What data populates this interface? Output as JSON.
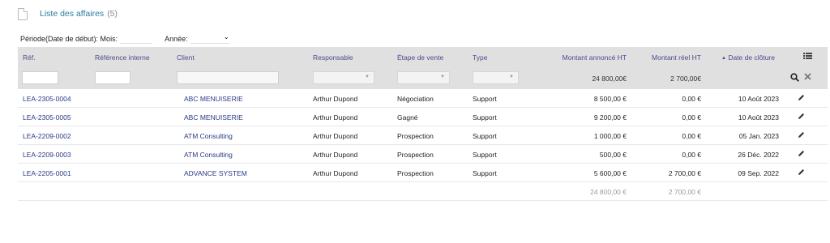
{
  "page": {
    "title": "Liste des affaires",
    "count": "(5)"
  },
  "filters": {
    "period_label": "Période(Date de début): Mois:",
    "year_label": "Année:"
  },
  "table": {
    "headers": {
      "ref": "Réf.",
      "ref_int": "Référence interne",
      "client": "Client",
      "responsable": "Responsable",
      "etape": "Étape de vente",
      "type": "Type",
      "montant_annonce": "Montant annoncé HT",
      "montant_reel": "Montant réel HT",
      "date_cloture": "Date de clôture",
      "sort_indicator": "▲"
    },
    "header_totals": {
      "montant_annonce": "24 800,00€",
      "montant_reel": "2 700,00€"
    },
    "rows": [
      {
        "ref": "LEA-2305-0004",
        "client": "ABC MENUISERIE",
        "responsable": "Arthur Dupond",
        "etape": "Négociation",
        "type": "Support",
        "montant_annonce": "8 500,00 €",
        "montant_reel": "0,00 €",
        "date": "10 Août 2023"
      },
      {
        "ref": "LEA-2305-0005",
        "client": "ABC MENUISERIE",
        "responsable": "Arthur Dupond",
        "etape": "Gagné",
        "type": "Support",
        "montant_annonce": "9 200,00 €",
        "montant_reel": "0,00 €",
        "date": "10 Août 2023"
      },
      {
        "ref": "LEA-2209-0002",
        "client": "ATM Consulting",
        "responsable": "Arthur Dupond",
        "etape": "Prospection",
        "type": "Support",
        "montant_annonce": "1 000,00 €",
        "montant_reel": "0,00 €",
        "date": "05 Jan. 2023"
      },
      {
        "ref": "LEA-2209-0003",
        "client": "ATM Consulting",
        "responsable": "Arthur Dupond",
        "etape": "Prospection",
        "type": "Support",
        "montant_annonce": "500,00 €",
        "montant_reel": "0,00 €",
        "date": "26 Déc. 2022"
      },
      {
        "ref": "LEA-2205-0001",
        "client": "ADVANCE SYSTEM",
        "responsable": "Arthur Dupond",
        "etape": "Prospection",
        "type": "Support",
        "montant_annonce": "5 600,00 €",
        "montant_reel": "2 700,00 €",
        "date": "09 Sep. 2022"
      }
    ],
    "footer_totals": {
      "montant_annonce": "24 800,00 €",
      "montant_reel": "2 700,00 €"
    }
  },
  "icons": {
    "columns": "list-columns-icon",
    "search": "search-icon",
    "clear": "close-icon",
    "edit": "pencil-icon",
    "document": "document-icon",
    "company": "building-icon"
  }
}
